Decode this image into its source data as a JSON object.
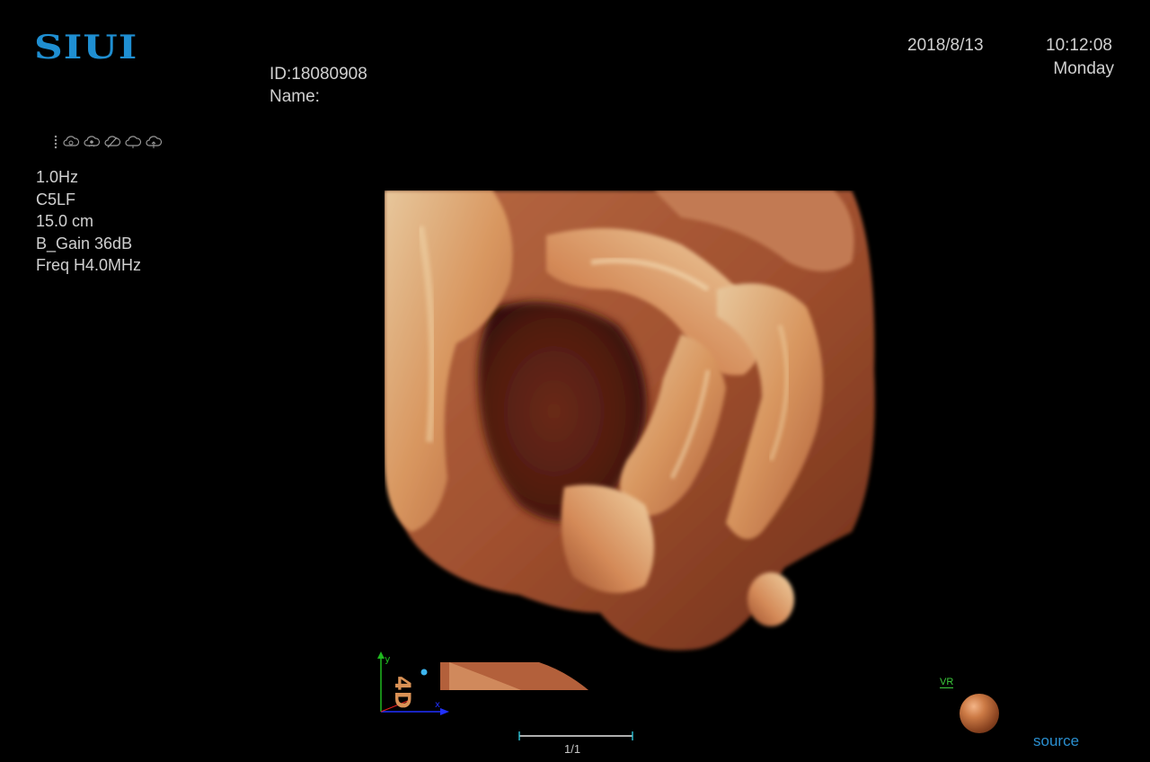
{
  "brand": {
    "logo_text": "SIUI",
    "color": "#1f8fd2"
  },
  "header": {
    "patient_id": "ID:18080908",
    "patient_name": "Name:",
    "date": "2018/8/13",
    "time": "10:12:08",
    "weekday": "Monday"
  },
  "status_icons": [
    "divider-dots",
    "cloud-sync-icon",
    "cloud-user-icon",
    "cloud-off-icon",
    "cloud-outline-icon",
    "cloud-upload-icon"
  ],
  "params": {
    "frame_rate": "1.0Hz",
    "probe": "C5LF",
    "depth": "15.0 cm",
    "gain": "B_Gain 36dB",
    "frequency": "Freq H4.0MHz"
  },
  "viewer": {
    "page_indicator": "1/1",
    "mode_label": "VR",
    "source_label": "source",
    "axis_y": "y",
    "axis_x": "x",
    "badge": "4D"
  },
  "colors": {
    "tissue_highlight": "#e9c39a",
    "tissue_mid": "#c9774e",
    "tissue_dark": "#6a2c1c",
    "axis_green": "#1fb81f",
    "axis_blue": "#2030ff",
    "axis_red": "#e02020",
    "mode_label": "#3ccc3c",
    "source_label": "#2a8fd0"
  }
}
